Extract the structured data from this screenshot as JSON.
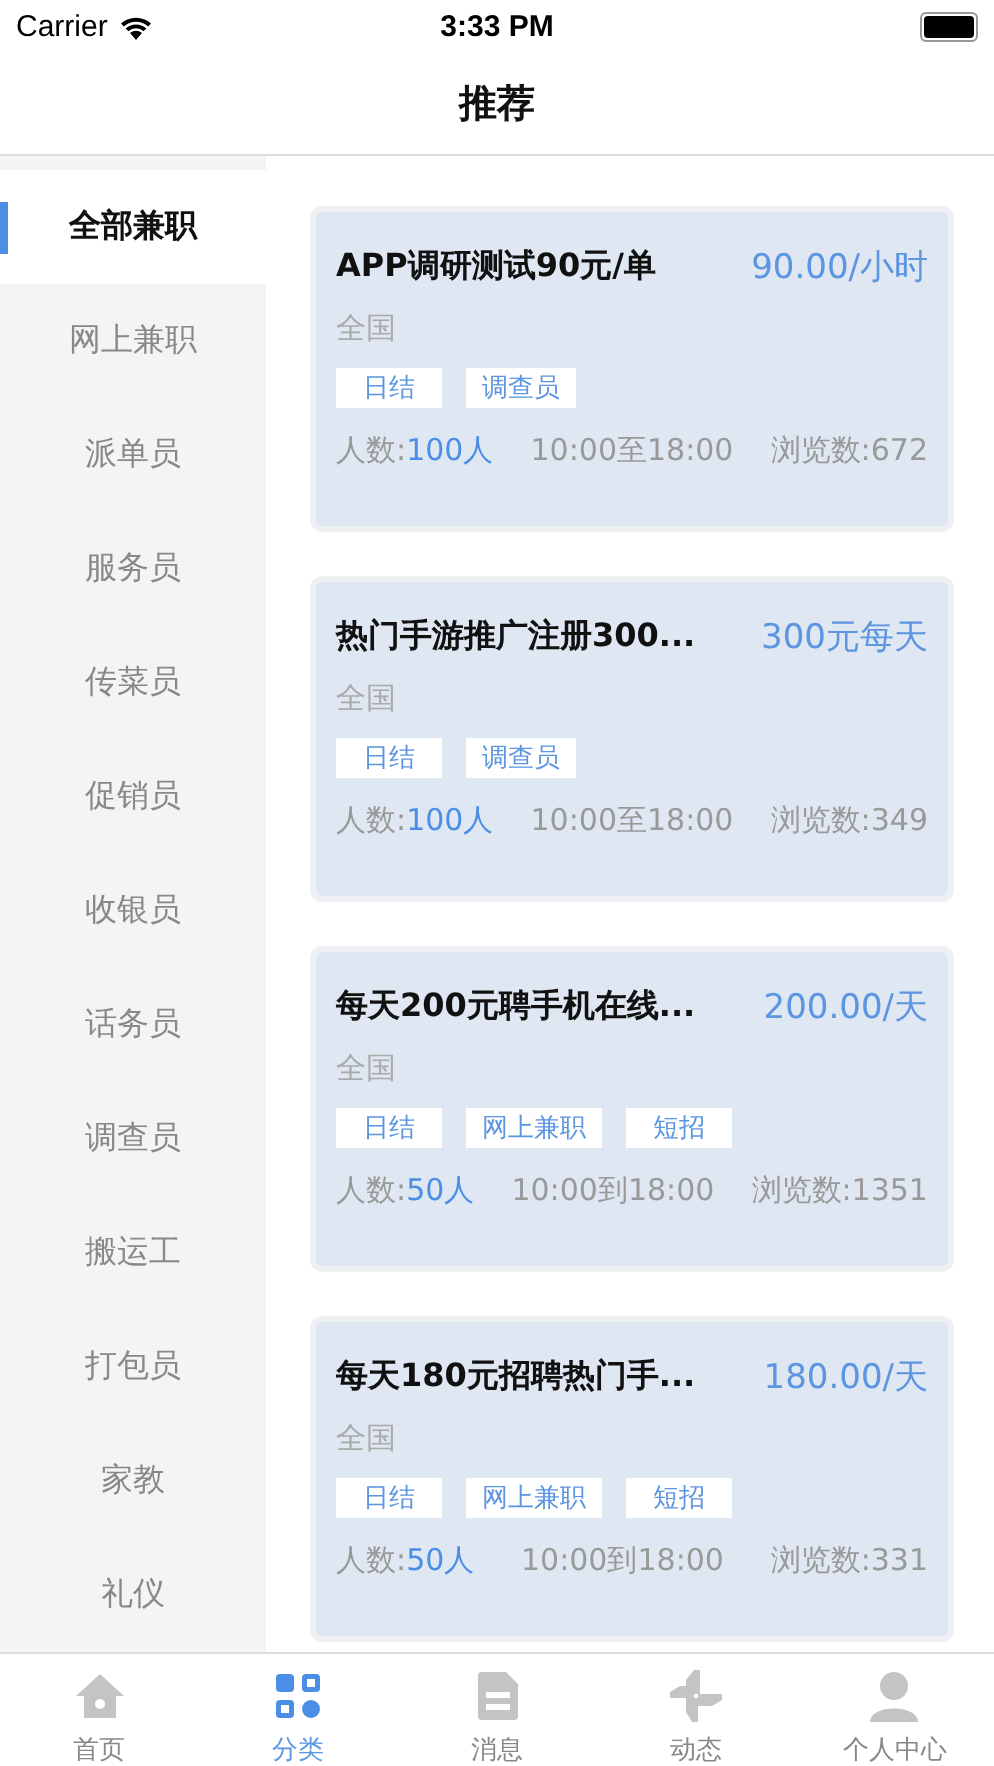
{
  "status_bar": {
    "carrier": "Carrier",
    "time": "3:33 PM"
  },
  "nav": {
    "title": "推荐"
  },
  "sidebar": {
    "items": [
      {
        "label": "全部兼职",
        "selected": true
      },
      {
        "label": "网上兼职",
        "selected": false
      },
      {
        "label": "派单员",
        "selected": false
      },
      {
        "label": "服务员",
        "selected": false
      },
      {
        "label": "传菜员",
        "selected": false
      },
      {
        "label": "促销员",
        "selected": false
      },
      {
        "label": "收银员",
        "selected": false
      },
      {
        "label": "话务员",
        "selected": false
      },
      {
        "label": "调查员",
        "selected": false
      },
      {
        "label": "搬运工",
        "selected": false
      },
      {
        "label": "打包员",
        "selected": false
      },
      {
        "label": "家教",
        "selected": false
      },
      {
        "label": "礼仪",
        "selected": false
      }
    ]
  },
  "jobs": [
    {
      "title": "APP调研测试90元/单",
      "pay": "90.00/小时",
      "area": "全国",
      "tags": [
        "日结",
        "调查员"
      ],
      "count_label": "人数:",
      "count": "100人",
      "hours": "10:00至18:00",
      "views": "浏览数:672"
    },
    {
      "title": "热门手游推广注册300...",
      "pay": "300元每天",
      "area": "全国",
      "tags": [
        "日结",
        "调查员"
      ],
      "count_label": "人数:",
      "count": "100人",
      "hours": "10:00至18:00",
      "views": "浏览数:349"
    },
    {
      "title": "每天200元聘手机在线...",
      "pay": "200.00/天",
      "area": "全国",
      "tags": [
        "日结",
        "网上兼职",
        "短招"
      ],
      "count_label": "人数:",
      "count": "50人",
      "hours": "10:00到18:00",
      "views": "浏览数:1351"
    },
    {
      "title": "每天180元招聘热门手...",
      "pay": "180.00/天",
      "area": "全国",
      "tags": [
        "日结",
        "网上兼职",
        "短招"
      ],
      "count_label": "人数:",
      "count": "50人",
      "hours": "10:00到18:00",
      "views": "浏览数:331"
    }
  ],
  "tab_bar": [
    {
      "label": "首页",
      "kind": "home",
      "selected": false
    },
    {
      "label": "分类",
      "kind": "grid",
      "selected": true
    },
    {
      "label": "消息",
      "kind": "message",
      "selected": false
    },
    {
      "label": "动态",
      "kind": "pinwheel",
      "selected": false
    },
    {
      "label": "个人中心",
      "kind": "person",
      "selected": false
    }
  ]
}
